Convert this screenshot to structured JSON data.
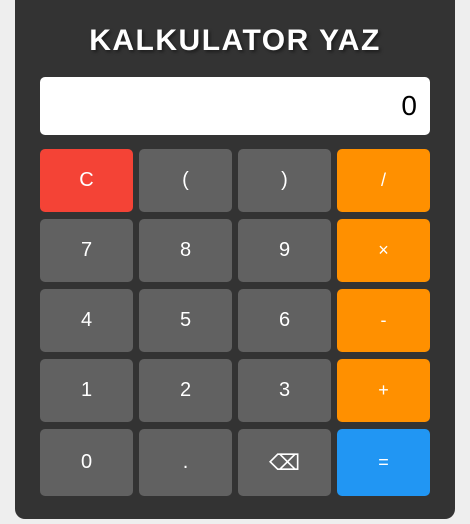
{
  "app": {
    "title": "KALKULATOR YAZ"
  },
  "display": {
    "value": "0"
  },
  "colors": {
    "panel": "#333333",
    "number_key": "#616161",
    "operator_key": "#ff9000",
    "clear_key": "#f44336",
    "equals_key": "#2196f3",
    "display_bg": "#ffffff"
  },
  "keys": {
    "clear": "C",
    "open_paren": "(",
    "close_paren": ")",
    "divide": "/",
    "seven": "7",
    "eight": "8",
    "nine": "9",
    "multiply": "×",
    "four": "4",
    "five": "5",
    "six": "6",
    "subtract": "-",
    "one": "1",
    "two": "2",
    "three": "3",
    "add": "+",
    "zero": "0",
    "decimal": ".",
    "backspace": "⌫",
    "equals": "="
  },
  "icons": {
    "backspace": "backspace-icon"
  }
}
